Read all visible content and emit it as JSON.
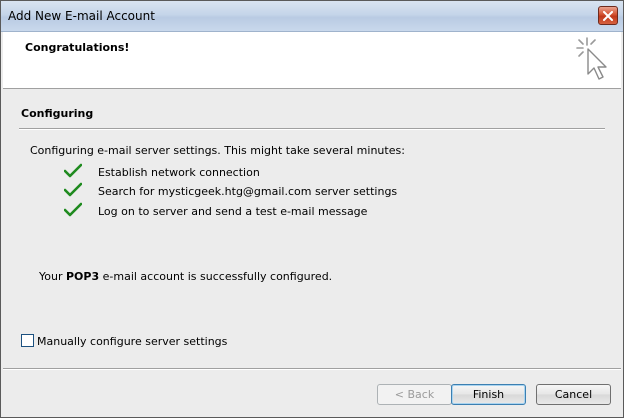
{
  "window": {
    "title": "Add New E-mail Account"
  },
  "header": {
    "heading": "Congratulations!"
  },
  "section": {
    "title": "Configuring",
    "intro": "Configuring e-mail server settings. This might take several minutes:",
    "steps": [
      {
        "label": "Establish network connection",
        "done": true
      },
      {
        "label": "Search for mysticgeek.htg@gmail.com server settings",
        "done": true
      },
      {
        "label": "Log on to server and send a test e-mail message",
        "done": true
      }
    ]
  },
  "status": {
    "prefix": "Your ",
    "protocol": "POP3",
    "suffix": " e-mail account is successfully configured."
  },
  "manual_config": {
    "label": "Manually configure server settings",
    "checked": false
  },
  "buttons": {
    "back": "< Back",
    "finish": "Finish",
    "cancel": "Cancel"
  },
  "colors": {
    "check": "#1f8a1f",
    "title_bar": "#c5d5e9",
    "close": "#c0381b"
  },
  "icons": {
    "close": "close-icon",
    "header": "sparkle-cursor-icon",
    "check": "checkmark-icon"
  }
}
